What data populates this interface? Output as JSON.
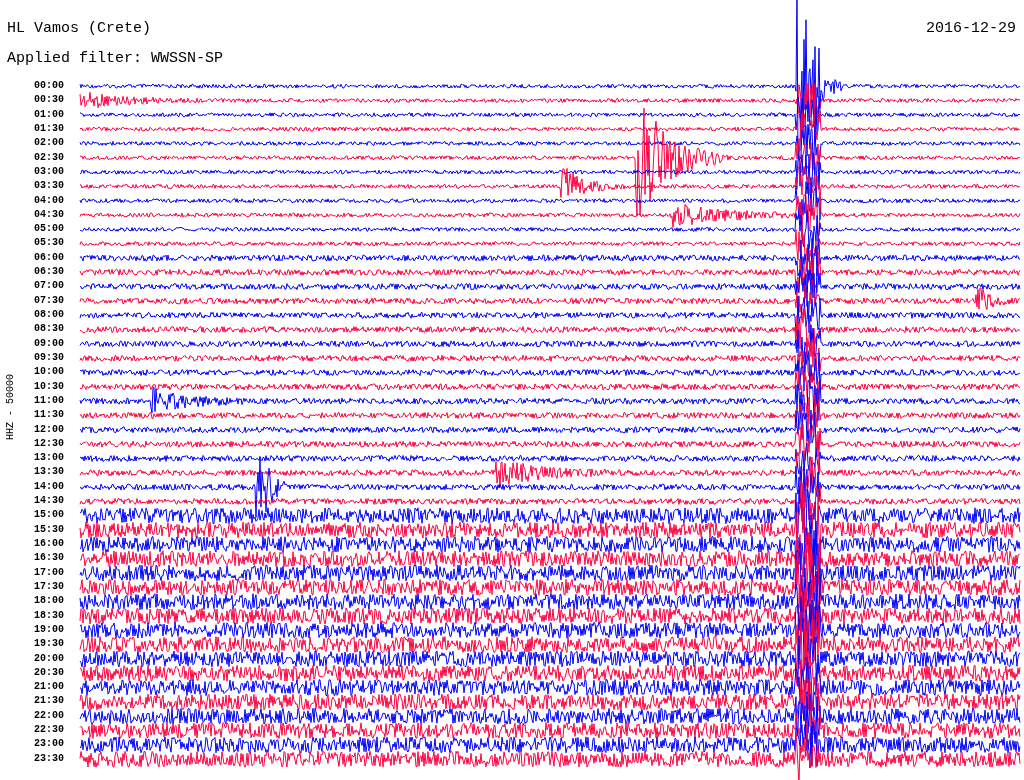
{
  "station": "HL Vamos (Crete)",
  "date": "2016-12-29",
  "filter": "Applied filter: WWSSN-SP",
  "axis_label": "HHZ - 50000",
  "rows": [
    {
      "time": "00:00",
      "color": "#0000ff"
    },
    {
      "time": "00:30",
      "color": "#ff0040"
    },
    {
      "time": "01:00",
      "color": "#0000ff"
    },
    {
      "time": "01:30",
      "color": "#ff0040"
    },
    {
      "time": "02:00",
      "color": "#0000ff"
    },
    {
      "time": "02:30",
      "color": "#ff0040"
    },
    {
      "time": "03:00",
      "color": "#0000ff"
    },
    {
      "time": "03:30",
      "color": "#ff0040"
    },
    {
      "time": "04:00",
      "color": "#0000ff"
    },
    {
      "time": "04:30",
      "color": "#ff0040"
    },
    {
      "time": "05:00",
      "color": "#0000ff"
    },
    {
      "time": "05:30",
      "color": "#ff0040"
    },
    {
      "time": "06:00",
      "color": "#0000ff"
    },
    {
      "time": "06:30",
      "color": "#ff0040"
    },
    {
      "time": "07:00",
      "color": "#0000ff"
    },
    {
      "time": "07:30",
      "color": "#ff0040"
    },
    {
      "time": "08:00",
      "color": "#0000ff"
    },
    {
      "time": "08:30",
      "color": "#ff0040"
    },
    {
      "time": "09:00",
      "color": "#0000ff"
    },
    {
      "time": "09:30",
      "color": "#ff0040"
    },
    {
      "time": "10:00",
      "color": "#0000ff"
    },
    {
      "time": "10:30",
      "color": "#ff0040"
    },
    {
      "time": "11:00",
      "color": "#0000ff"
    },
    {
      "time": "11:30",
      "color": "#ff0040"
    },
    {
      "time": "12:00",
      "color": "#0000ff"
    },
    {
      "time": "12:30",
      "color": "#ff0040"
    },
    {
      "time": "13:00",
      "color": "#0000ff"
    },
    {
      "time": "13:30",
      "color": "#ff0040"
    },
    {
      "time": "14:00",
      "color": "#0000ff"
    },
    {
      "time": "14:30",
      "color": "#ff0040"
    },
    {
      "time": "15:00",
      "color": "#0000ff"
    },
    {
      "time": "15:30",
      "color": "#ff0040"
    },
    {
      "time": "16:00",
      "color": "#0000ff"
    },
    {
      "time": "16:30",
      "color": "#ff0040"
    },
    {
      "time": "17:00",
      "color": "#0000ff"
    },
    {
      "time": "17:30",
      "color": "#ff0040"
    },
    {
      "time": "18:00",
      "color": "#0000ff"
    },
    {
      "time": "18:30",
      "color": "#ff0040"
    },
    {
      "time": "19:00",
      "color": "#0000ff"
    },
    {
      "time": "19:30",
      "color": "#ff0040"
    },
    {
      "time": "20:00",
      "color": "#0000ff"
    },
    {
      "time": "20:30",
      "color": "#ff0040"
    },
    {
      "time": "21:00",
      "color": "#0000ff"
    },
    {
      "time": "21:30",
      "color": "#ff0040"
    },
    {
      "time": "22:00",
      "color": "#0000ff"
    },
    {
      "time": "22:30",
      "color": "#ff0040"
    },
    {
      "time": "23:00",
      "color": "#0000ff"
    },
    {
      "time": "23:30",
      "color": "#ff0040"
    }
  ]
}
